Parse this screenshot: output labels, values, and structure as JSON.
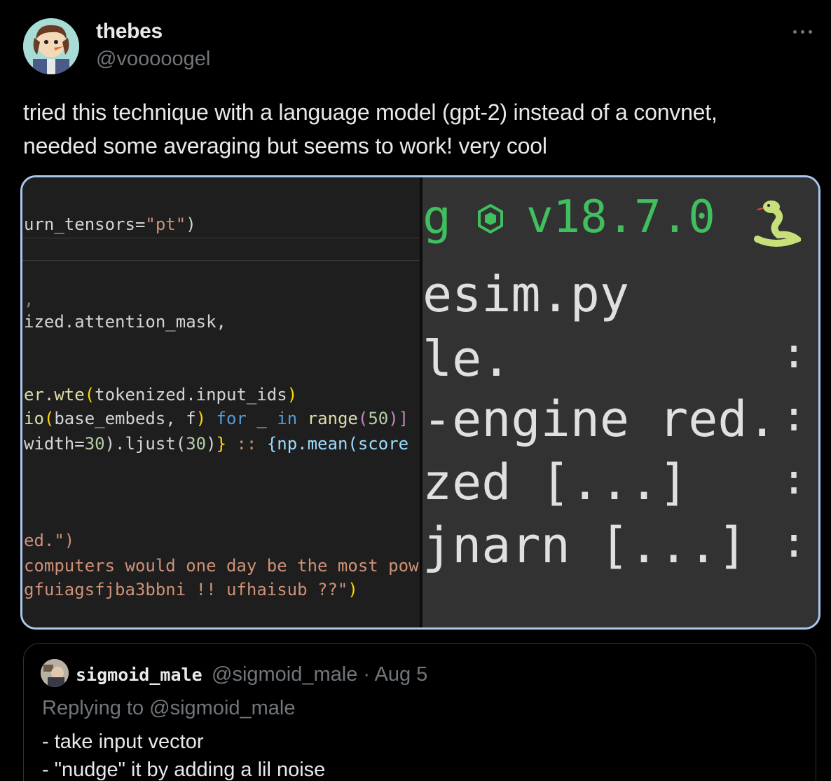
{
  "author": {
    "display_name": "thebes",
    "handle": "@vooooogel"
  },
  "tweet": {
    "line1": "tried this technique with a language model (gpt-2) instead of a convnet,",
    "line2": "needed some averaging but seems to work! very cool"
  },
  "media": {
    "code": {
      "l1a": "urn_tensors=",
      "l1b": "\"pt\"",
      "l1c": ")",
      "l2": ",",
      "l3": "ized.attention_mask,",
      "l4a": "er.wte",
      "l4b": "(",
      "l4c": "tokenized.input_ids",
      "l4d": ")",
      "l5a": "io",
      "l5b": "(",
      "l5c": "base_embeds, f",
      "l5d": ")",
      "l5e": " for",
      "l5f": " _ ",
      "l5g": "in",
      "l5h": " range",
      "l5i": "(",
      "l5j": "50",
      "l5k": ")]",
      "l6a": " width=",
      "l6b": "30",
      "l6c": ").ljust(",
      "l6d": "30",
      "l6e": ")",
      "l6f": "}",
      "l6g": " :: ",
      "l6h": "{np.mean(score",
      "l7": "ed.\")",
      "l8": "computers would one day be the most pow",
      "l9a": "gfuiagsfjba3bbni !! ufhaisub ??\"",
      "l9b": ")"
    },
    "terminal": {
      "version_prefix": "g",
      "version": "v18.7.0",
      "line1": "esim.py",
      "line2": "le.",
      "line3": "-engine red.",
      "line4": "zed [...]",
      "line5": "jnarn [...]",
      "colon": ":"
    }
  },
  "quoted": {
    "name": "sigmoid_male",
    "meta": "@sigmoid_male · Aug 5",
    "replying": "Replying to @sigmoid_male",
    "line1": "- take input vector",
    "line2": "- \"nudge\" it by adding a lil noise"
  },
  "icons": {
    "more": "more-horizontal-icon",
    "node": "nodejs-icon",
    "python": "python-snake-icon"
  },
  "colors": {
    "background": "#000000",
    "text": "#e7e9ea",
    "muted": "#71767b",
    "media_border": "#a9c8ee"
  }
}
